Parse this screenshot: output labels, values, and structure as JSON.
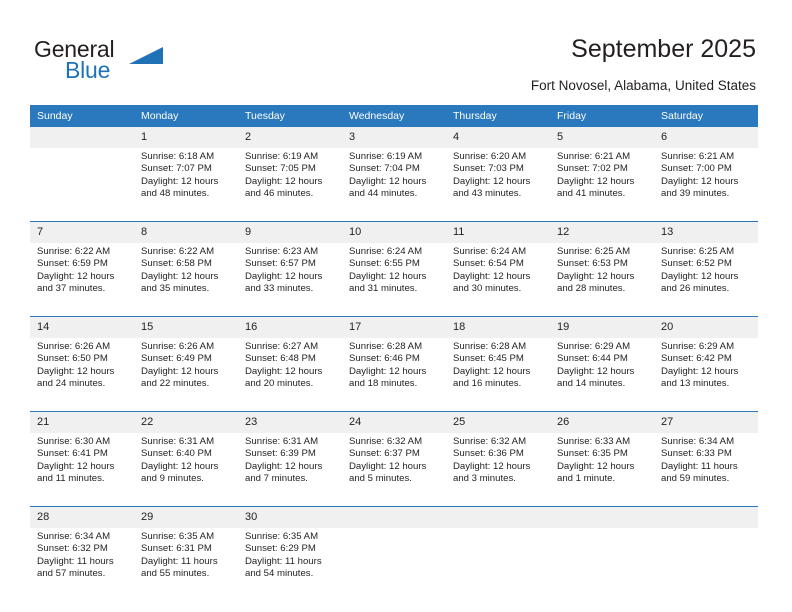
{
  "brand": {
    "word_one": "General",
    "word_two": "Blue",
    "triangle_icon": "triangle-icon"
  },
  "header": {
    "title": "September 2025",
    "location": "Fort Novosel, Alabama, United States"
  },
  "theme": {
    "header_blue": "#2a78bd",
    "daynum_gray": "#f0f0f0",
    "text": "#231f20",
    "brand_blue": "#1f72b8"
  },
  "weekday_headers": [
    "Sunday",
    "Monday",
    "Tuesday",
    "Wednesday",
    "Thursday",
    "Friday",
    "Saturday"
  ],
  "weeks": [
    {
      "days": [
        {
          "num": "",
          "sunrise": "",
          "sunset": "",
          "daylight_1": "",
          "daylight_2": ""
        },
        {
          "num": "1",
          "sunrise": "Sunrise: 6:18 AM",
          "sunset": "Sunset: 7:07 PM",
          "daylight_1": "Daylight: 12 hours",
          "daylight_2": "and 48 minutes."
        },
        {
          "num": "2",
          "sunrise": "Sunrise: 6:19 AM",
          "sunset": "Sunset: 7:05 PM",
          "daylight_1": "Daylight: 12 hours",
          "daylight_2": "and 46 minutes."
        },
        {
          "num": "3",
          "sunrise": "Sunrise: 6:19 AM",
          "sunset": "Sunset: 7:04 PM",
          "daylight_1": "Daylight: 12 hours",
          "daylight_2": "and 44 minutes."
        },
        {
          "num": "4",
          "sunrise": "Sunrise: 6:20 AM",
          "sunset": "Sunset: 7:03 PM",
          "daylight_1": "Daylight: 12 hours",
          "daylight_2": "and 43 minutes."
        },
        {
          "num": "5",
          "sunrise": "Sunrise: 6:21 AM",
          "sunset": "Sunset: 7:02 PM",
          "daylight_1": "Daylight: 12 hours",
          "daylight_2": "and 41 minutes."
        },
        {
          "num": "6",
          "sunrise": "Sunrise: 6:21 AM",
          "sunset": "Sunset: 7:00 PM",
          "daylight_1": "Daylight: 12 hours",
          "daylight_2": "and 39 minutes."
        }
      ]
    },
    {
      "days": [
        {
          "num": "7",
          "sunrise": "Sunrise: 6:22 AM",
          "sunset": "Sunset: 6:59 PM",
          "daylight_1": "Daylight: 12 hours",
          "daylight_2": "and 37 minutes."
        },
        {
          "num": "8",
          "sunrise": "Sunrise: 6:22 AM",
          "sunset": "Sunset: 6:58 PM",
          "daylight_1": "Daylight: 12 hours",
          "daylight_2": "and 35 minutes."
        },
        {
          "num": "9",
          "sunrise": "Sunrise: 6:23 AM",
          "sunset": "Sunset: 6:57 PM",
          "daylight_1": "Daylight: 12 hours",
          "daylight_2": "and 33 minutes."
        },
        {
          "num": "10",
          "sunrise": "Sunrise: 6:24 AM",
          "sunset": "Sunset: 6:55 PM",
          "daylight_1": "Daylight: 12 hours",
          "daylight_2": "and 31 minutes."
        },
        {
          "num": "11",
          "sunrise": "Sunrise: 6:24 AM",
          "sunset": "Sunset: 6:54 PM",
          "daylight_1": "Daylight: 12 hours",
          "daylight_2": "and 30 minutes."
        },
        {
          "num": "12",
          "sunrise": "Sunrise: 6:25 AM",
          "sunset": "Sunset: 6:53 PM",
          "daylight_1": "Daylight: 12 hours",
          "daylight_2": "and 28 minutes."
        },
        {
          "num": "13",
          "sunrise": "Sunrise: 6:25 AM",
          "sunset": "Sunset: 6:52 PM",
          "daylight_1": "Daylight: 12 hours",
          "daylight_2": "and 26 minutes."
        }
      ]
    },
    {
      "days": [
        {
          "num": "14",
          "sunrise": "Sunrise: 6:26 AM",
          "sunset": "Sunset: 6:50 PM",
          "daylight_1": "Daylight: 12 hours",
          "daylight_2": "and 24 minutes."
        },
        {
          "num": "15",
          "sunrise": "Sunrise: 6:26 AM",
          "sunset": "Sunset: 6:49 PM",
          "daylight_1": "Daylight: 12 hours",
          "daylight_2": "and 22 minutes."
        },
        {
          "num": "16",
          "sunrise": "Sunrise: 6:27 AM",
          "sunset": "Sunset: 6:48 PM",
          "daylight_1": "Daylight: 12 hours",
          "daylight_2": "and 20 minutes."
        },
        {
          "num": "17",
          "sunrise": "Sunrise: 6:28 AM",
          "sunset": "Sunset: 6:46 PM",
          "daylight_1": "Daylight: 12 hours",
          "daylight_2": "and 18 minutes."
        },
        {
          "num": "18",
          "sunrise": "Sunrise: 6:28 AM",
          "sunset": "Sunset: 6:45 PM",
          "daylight_1": "Daylight: 12 hours",
          "daylight_2": "and 16 minutes."
        },
        {
          "num": "19",
          "sunrise": "Sunrise: 6:29 AM",
          "sunset": "Sunset: 6:44 PM",
          "daylight_1": "Daylight: 12 hours",
          "daylight_2": "and 14 minutes."
        },
        {
          "num": "20",
          "sunrise": "Sunrise: 6:29 AM",
          "sunset": "Sunset: 6:42 PM",
          "daylight_1": "Daylight: 12 hours",
          "daylight_2": "and 13 minutes."
        }
      ]
    },
    {
      "days": [
        {
          "num": "21",
          "sunrise": "Sunrise: 6:30 AM",
          "sunset": "Sunset: 6:41 PM",
          "daylight_1": "Daylight: 12 hours",
          "daylight_2": "and 11 minutes."
        },
        {
          "num": "22",
          "sunrise": "Sunrise: 6:31 AM",
          "sunset": "Sunset: 6:40 PM",
          "daylight_1": "Daylight: 12 hours",
          "daylight_2": "and 9 minutes."
        },
        {
          "num": "23",
          "sunrise": "Sunrise: 6:31 AM",
          "sunset": "Sunset: 6:39 PM",
          "daylight_1": "Daylight: 12 hours",
          "daylight_2": "and 7 minutes."
        },
        {
          "num": "24",
          "sunrise": "Sunrise: 6:32 AM",
          "sunset": "Sunset: 6:37 PM",
          "daylight_1": "Daylight: 12 hours",
          "daylight_2": "and 5 minutes."
        },
        {
          "num": "25",
          "sunrise": "Sunrise: 6:32 AM",
          "sunset": "Sunset: 6:36 PM",
          "daylight_1": "Daylight: 12 hours",
          "daylight_2": "and 3 minutes."
        },
        {
          "num": "26",
          "sunrise": "Sunrise: 6:33 AM",
          "sunset": "Sunset: 6:35 PM",
          "daylight_1": "Daylight: 12 hours",
          "daylight_2": "and 1 minute."
        },
        {
          "num": "27",
          "sunrise": "Sunrise: 6:34 AM",
          "sunset": "Sunset: 6:33 PM",
          "daylight_1": "Daylight: 11 hours",
          "daylight_2": "and 59 minutes."
        }
      ]
    },
    {
      "days": [
        {
          "num": "28",
          "sunrise": "Sunrise: 6:34 AM",
          "sunset": "Sunset: 6:32 PM",
          "daylight_1": "Daylight: 11 hours",
          "daylight_2": "and 57 minutes."
        },
        {
          "num": "29",
          "sunrise": "Sunrise: 6:35 AM",
          "sunset": "Sunset: 6:31 PM",
          "daylight_1": "Daylight: 11 hours",
          "daylight_2": "and 55 minutes."
        },
        {
          "num": "30",
          "sunrise": "Sunrise: 6:35 AM",
          "sunset": "Sunset: 6:29 PM",
          "daylight_1": "Daylight: 11 hours",
          "daylight_2": "and 54 minutes."
        },
        {
          "num": "",
          "sunrise": "",
          "sunset": "",
          "daylight_1": "",
          "daylight_2": ""
        },
        {
          "num": "",
          "sunrise": "",
          "sunset": "",
          "daylight_1": "",
          "daylight_2": ""
        },
        {
          "num": "",
          "sunrise": "",
          "sunset": "",
          "daylight_1": "",
          "daylight_2": ""
        },
        {
          "num": "",
          "sunrise": "",
          "sunset": "",
          "daylight_1": "",
          "daylight_2": ""
        }
      ]
    }
  ]
}
